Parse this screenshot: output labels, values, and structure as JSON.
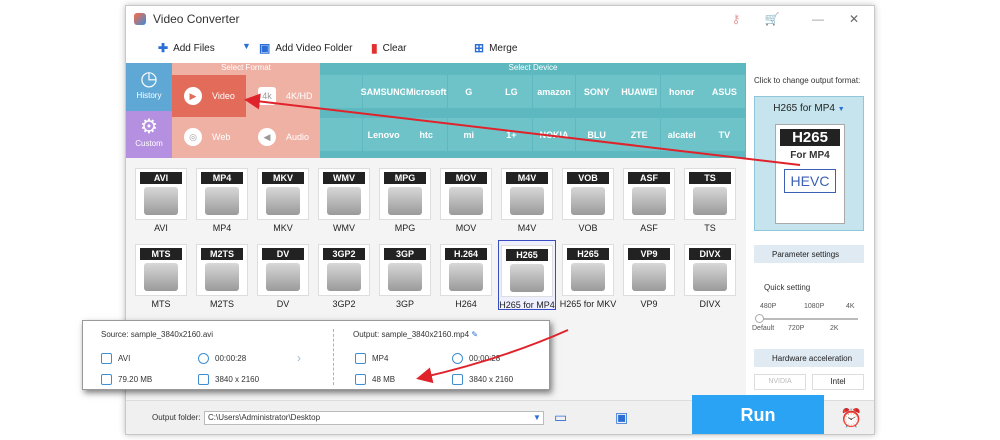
{
  "window": {
    "title": "Video Converter"
  },
  "toolbar": {
    "add_files": "Add Files",
    "add_video_folder": "Add Video Folder",
    "clear": "Clear",
    "merge": "Merge"
  },
  "select_format_label": "Select Format",
  "select_device_label": "Select Device",
  "side": {
    "history": "History",
    "custom": "Custom"
  },
  "format_categories": [
    {
      "label": "Video"
    },
    {
      "label": "4K/HD"
    },
    {
      "label": "Web"
    },
    {
      "label": "Audio"
    }
  ],
  "devices_row1": [
    "",
    "SAMSUNG",
    "Microsoft",
    "G",
    "LG",
    "amazon",
    "SONY",
    "HUAWEI",
    "honor",
    "ASUS"
  ],
  "devices_row2": [
    "",
    "Lenovo",
    "htc",
    "mi",
    "1+",
    "NOKIA",
    "BLU",
    "ZTE",
    "alcatel",
    "TV"
  ],
  "formats_row1": [
    {
      "tag": "AVI",
      "label": "AVI"
    },
    {
      "tag": "MP4",
      "label": "MP4"
    },
    {
      "tag": "MKV",
      "label": "MKV"
    },
    {
      "tag": "WMV",
      "label": "WMV"
    },
    {
      "tag": "MPG",
      "label": "MPG"
    },
    {
      "tag": "MOV",
      "label": "MOV"
    },
    {
      "tag": "M4V",
      "label": "M4V"
    },
    {
      "tag": "VOB",
      "label": "VOB"
    },
    {
      "tag": "ASF",
      "label": "ASF"
    },
    {
      "tag": "TS",
      "label": "TS"
    }
  ],
  "formats_row2": [
    {
      "tag": "MTS",
      "label": "MTS"
    },
    {
      "tag": "M2TS",
      "label": "M2TS"
    },
    {
      "tag": "DV",
      "label": "DV"
    },
    {
      "tag": "3GP2",
      "label": "3GP2"
    },
    {
      "tag": "3GP",
      "label": "3GP"
    },
    {
      "tag": "H.264",
      "label": "H264"
    },
    {
      "tag": "H265",
      "label": "H265 for MP4"
    },
    {
      "tag": "H265",
      "label": "H265 for MKV"
    },
    {
      "tag": "VP9",
      "label": "VP9"
    },
    {
      "tag": "DIVX",
      "label": "DIVX"
    }
  ],
  "right_panel": {
    "click_label": "Click to change output format:",
    "selected_format": "H265 for MP4",
    "big_top": "H265",
    "big_mid": "For MP4",
    "big_bottom": "HEVC",
    "parameter_settings": "Parameter settings",
    "quick_setting": "Quick setting",
    "q_labels_top": [
      "480P",
      "1080P",
      "4K"
    ],
    "q_labels_bottom": [
      "Default",
      "720P",
      "2K"
    ],
    "hw_accel": "Hardware acceleration",
    "nvidia": "NVIDIA",
    "intel": "Intel"
  },
  "popup": {
    "source": "Source: sample_3840x2160.avi",
    "output": "Output: sample_3840x2160.mp4",
    "src_format": "AVI",
    "src_duration": "00:00:28",
    "src_size": "79.20 MB",
    "src_resolution": "3840 x 2160",
    "out_format": "MP4",
    "out_duration": "00:00:28",
    "out_size": "48 MB",
    "out_resolution": "3840 x 2160"
  },
  "bottom": {
    "output_folder_label": "Output folder:",
    "output_folder_value": "C:\\Users\\Administrator\\Desktop",
    "run": "Run"
  },
  "colors": {
    "format_bg": "#f0b1a5",
    "video_active": "#e36b5a",
    "device_bg": "#5eb8bf",
    "history_bg": "#5fa8d6",
    "custom_bg": "#b58fe0",
    "run": "#2aa3f5",
    "arrow": "#e0232b"
  }
}
